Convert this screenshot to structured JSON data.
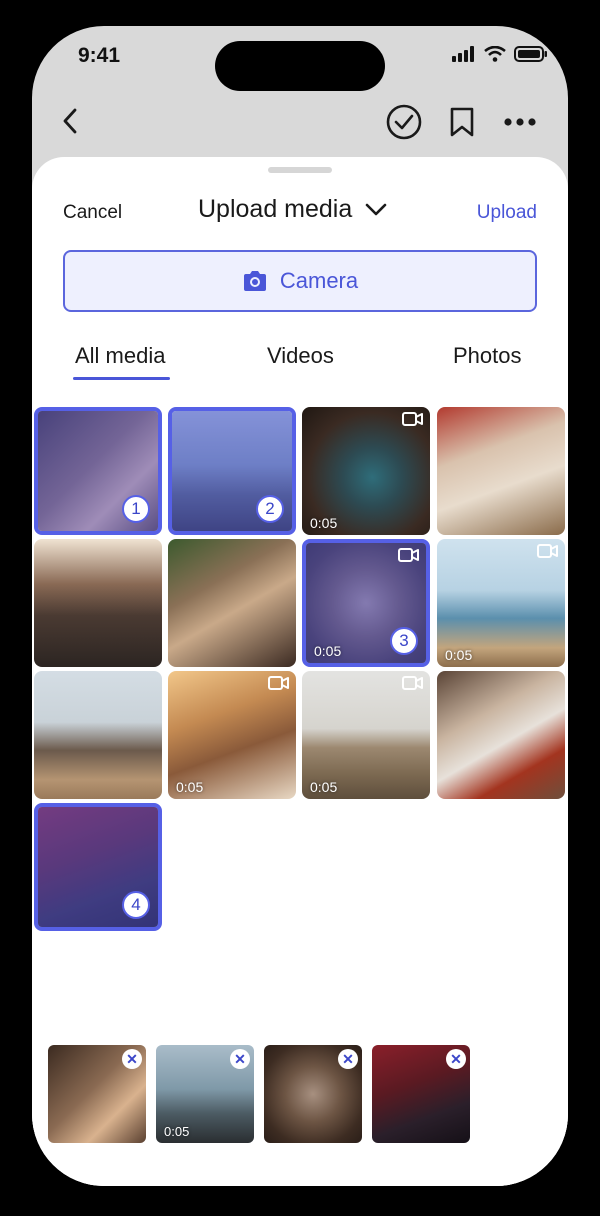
{
  "status": {
    "time": "9:41"
  },
  "sheet": {
    "cancel": "Cancel",
    "title": "Upload media",
    "upload": "Upload",
    "camera": "Camera"
  },
  "tabs": [
    {
      "label": "All media",
      "active": true
    },
    {
      "label": "Videos",
      "active": false
    },
    {
      "label": "Photos",
      "active": false
    }
  ],
  "grid": [
    {
      "selected": true,
      "number": "1",
      "video": false,
      "duration": ""
    },
    {
      "selected": true,
      "number": "2",
      "video": false,
      "duration": ""
    },
    {
      "selected": false,
      "number": "",
      "video": true,
      "duration": "0:05"
    },
    {
      "selected": false,
      "number": "",
      "video": false,
      "duration": ""
    },
    {
      "selected": false,
      "number": "",
      "video": false,
      "duration": ""
    },
    {
      "selected": false,
      "number": "",
      "video": false,
      "duration": ""
    },
    {
      "selected": true,
      "number": "3",
      "video": true,
      "duration": "0:05"
    },
    {
      "selected": false,
      "number": "",
      "video": true,
      "duration": "0:05"
    },
    {
      "selected": false,
      "number": "",
      "video": false,
      "duration": ""
    },
    {
      "selected": false,
      "number": "",
      "video": true,
      "duration": "0:05"
    },
    {
      "selected": false,
      "number": "",
      "video": true,
      "duration": "0:05"
    },
    {
      "selected": false,
      "number": "",
      "video": false,
      "duration": ""
    },
    {
      "selected": true,
      "number": "4",
      "video": false,
      "duration": ""
    }
  ],
  "tray": [
    {
      "duration": ""
    },
    {
      "duration": "0:05"
    },
    {
      "duration": ""
    },
    {
      "duration": ""
    }
  ],
  "colors": {
    "accent": "#4a56d8",
    "selection": "#5660e6",
    "camera_bg": "#eef0fe"
  }
}
